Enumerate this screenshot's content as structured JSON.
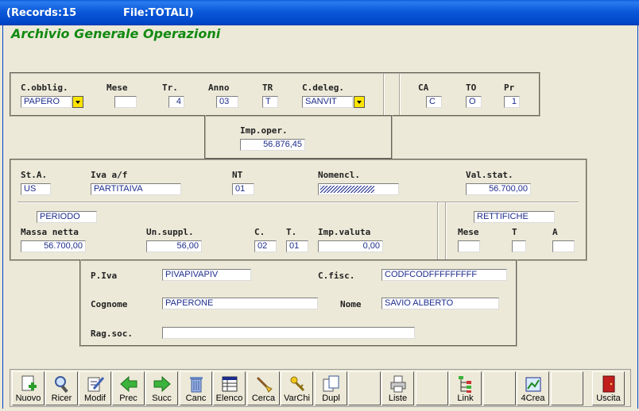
{
  "titlebar": {
    "records": "(Records:15",
    "file": "File:TOTALI)"
  },
  "app_title": "Archivio Generale Operazioni",
  "sec1": {
    "cobblig_label": "C.obblig.",
    "cobblig_value": "PAPERO",
    "mese_label": "Mese",
    "mese_value": "",
    "tr_label": "Tr.",
    "tr_value": "4",
    "anno_label": "Anno",
    "anno_value": "03",
    "tr2_label": "TR",
    "tr2_value": "T",
    "cdeleg_label": "C.deleg.",
    "cdeleg_value": "SANVIT",
    "ca_label": "CA",
    "ca_value": "C",
    "to_label": "TO",
    "to_value": "O",
    "pr_label": "Pr",
    "pr_value": "1"
  },
  "imp": {
    "label": "Imp.oper.",
    "value": "56.876,45"
  },
  "sec2": {
    "sta_label": "St.A.",
    "sta_value": "US",
    "iva_label": "Iva a/f",
    "iva_value": "PARTITAIVA",
    "nt_label": "NT",
    "nt_value": "01",
    "nomencl_label": "Nomencl.",
    "nomencl_value": "ZZZZZZZZZZ",
    "valstat_label": "Val.stat.",
    "valstat_value": "56.700,00",
    "periodo_value": "PERIODO",
    "rettifiche_value": "RETTIFICHE",
    "massa_label": "Massa netta",
    "massa_value": "56.700,00",
    "unsuppl_label": "Un.suppl.",
    "unsuppl_value": "56,00",
    "c_label": "C.",
    "c_value": "02",
    "t_label": "T.",
    "t_value": "01",
    "impval_label": "Imp.valuta",
    "impval_value": "0,00",
    "mese2_label": "Mese",
    "mese2_value": "",
    "t2_label": "T",
    "t2_value": "",
    "a_label": "A",
    "a_value": ""
  },
  "sec3": {
    "piva_label": "P.Iva",
    "piva_value": "PIVAPIVAPIV",
    "cfisc_label": "C.fisc.",
    "cfisc_value": "CODFCODFFFFFFFFF",
    "cognome_label": "Cognome",
    "cognome_value": "PAPERONE",
    "nome_label": "Nome",
    "nome_value": "SAVIO ALBERTO",
    "ragsoc_label": "Rag.soc.",
    "ragsoc_value": ""
  },
  "toolbar": {
    "nuovo": "Nuovo",
    "ricer": "Ricer",
    "modif": "Modif",
    "prec": "Prec",
    "succ": "Succ",
    "canc": "Canc",
    "elenco": "Elenco",
    "cerca": "Cerca",
    "varchi": "VarChi",
    "dupl": "Dupl",
    "liste": "Liste",
    "link": "Link",
    "crea4": "4Crea",
    "uscita": "Uscita"
  },
  "colors": {
    "title_green": "#118a11",
    "value_blue": "#1c2c8c",
    "dropdown_yellow": "#ffe500",
    "window_blue": "#0046c9"
  }
}
